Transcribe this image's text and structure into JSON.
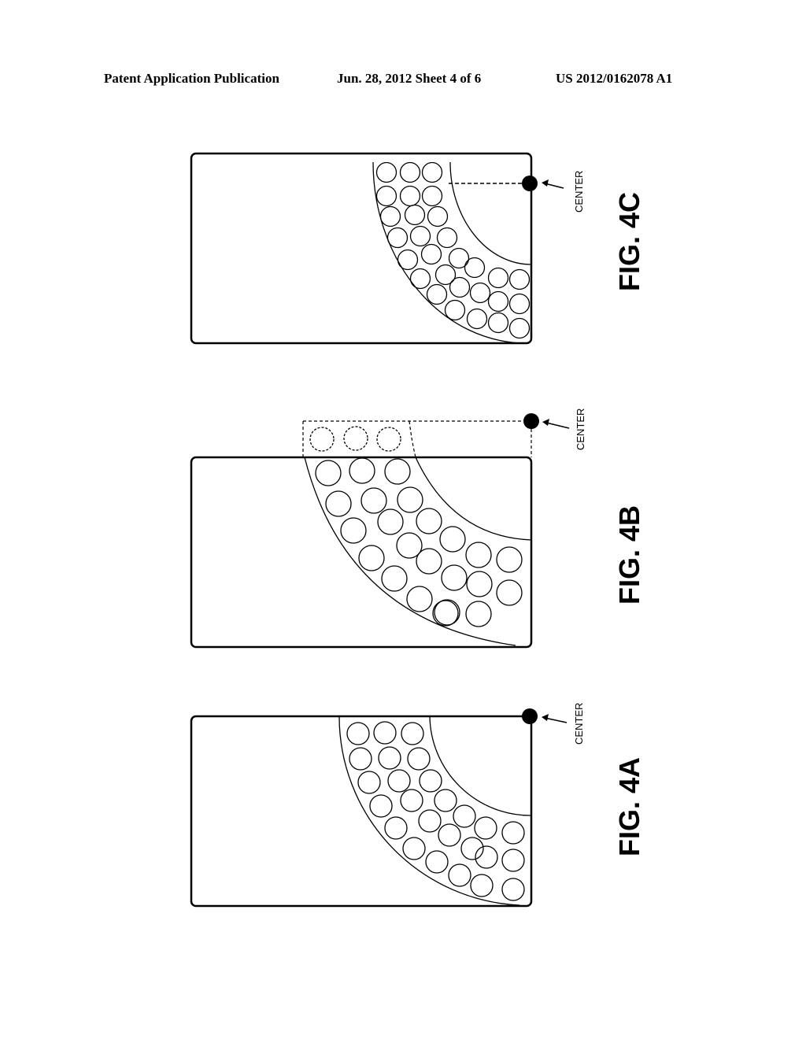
{
  "header": {
    "publication": "Patent Application Publication",
    "date_sheet": "Jun. 28, 2012   Sheet 4 of 6",
    "number": "US 2012/0162078 A1"
  },
  "figures": [
    {
      "id": "4C",
      "label": "FIG. 4C",
      "center_label": "CENTER",
      "center_position": "on right edge below top",
      "circle_count": 33,
      "ghost_circle_count": 0
    },
    {
      "id": "4B",
      "label": "FIG. 4B",
      "center_label": "CENTER",
      "center_position": "outside above top-right corner",
      "circle_count": 26,
      "ghost_circle_count": 3
    },
    {
      "id": "4A",
      "label": "FIG. 4A",
      "center_label": "CENTER",
      "center_position": "at top-right corner",
      "circle_count": 33,
      "ghost_circle_count": 0
    }
  ]
}
